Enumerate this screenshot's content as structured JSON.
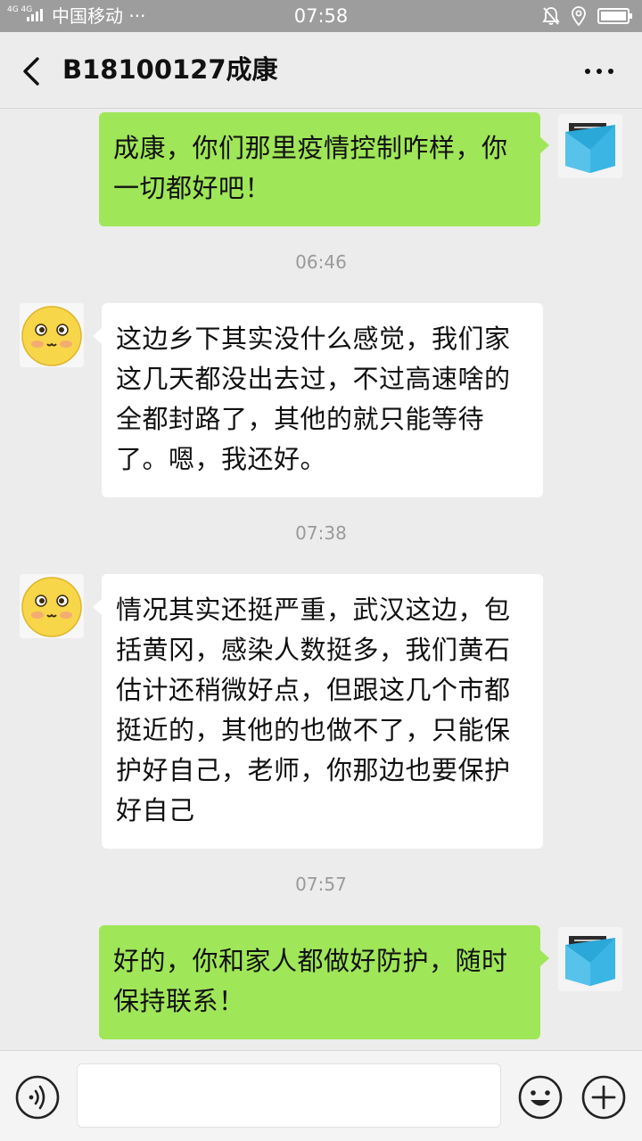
{
  "status_bar": {
    "network": "4G 4G",
    "carrier": "中国移动 ···",
    "time": "07:58"
  },
  "header": {
    "title": "B18100127成康"
  },
  "messages": [
    {
      "from": "me",
      "text": "成康，你们那里疫情控制咋样，你一切都好吧！"
    },
    {
      "type": "time",
      "text": "06:46"
    },
    {
      "from": "other",
      "text": "这边乡下其实没什么感觉，我们家这几天都没出去过，不过高速啥的全都封路了，其他的就只能等待了。嗯，我还好。"
    },
    {
      "type": "time",
      "text": "07:38"
    },
    {
      "from": "other",
      "text": "情况其实还挺严重，武汉这边，包括黄冈，感染人数挺多，我们黄石估计还稍微好点，但跟这几个市都挺近的，其他的也做不了，只能保护好自己，老师，你那边也要保护好自己"
    },
    {
      "type": "time",
      "text": "07:57"
    },
    {
      "from": "me",
      "text": "好的，你和家人都做好防护，随时保持联系！"
    }
  ],
  "input": {
    "value": "",
    "placeholder": ""
  },
  "colors": {
    "my_bubble": "#9fe658",
    "other_bubble": "#ffffff",
    "background": "#ececec",
    "status_bar": "#9d9d9d"
  },
  "icons": [
    "back-arrow-icon",
    "more-icon",
    "voice-icon",
    "emoji-icon",
    "plus-icon",
    "bell-off-icon",
    "location-icon",
    "battery-icon",
    "signal-icon"
  ]
}
